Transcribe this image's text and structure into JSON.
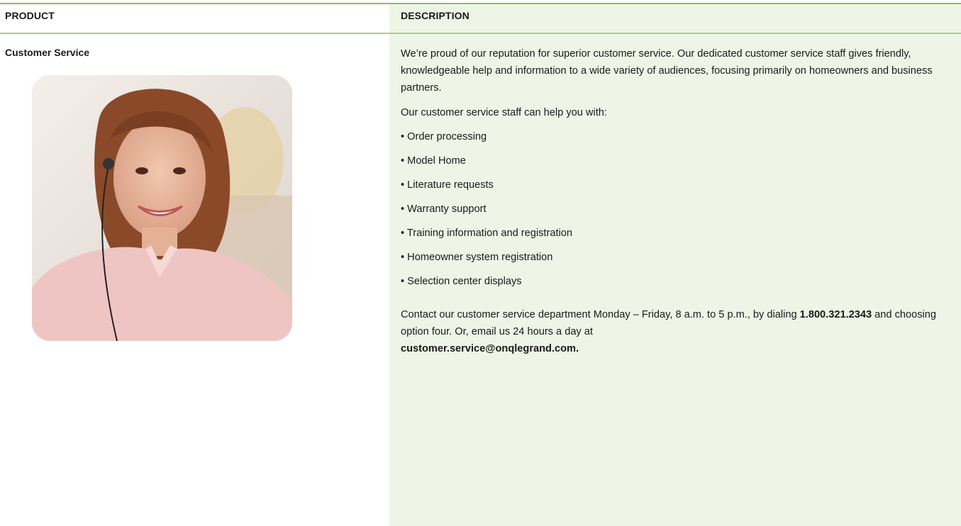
{
  "table": {
    "headers": {
      "product": "PRODUCT",
      "description": "DESCRIPTION"
    },
    "product": {
      "name": "Customer Service"
    },
    "description": {
      "intro": "We’re proud of our reputation for superior customer service. Our dedicated customer service staff gives friendly, knowledgeable help and information to a wide variety of audiences, focusing primarily on homeowners and business partners.",
      "lead": "Our customer service staff can help you with:",
      "bullets": [
        "• Order processing",
        "• Model Home",
        "• Literature requests",
        "• Warranty support",
        "• Training information and registration",
        "• Homeowner system registration",
        "• Selection center displays"
      ],
      "contact": {
        "text_1": "Contact our customer service department Monday – Friday, 8 a.m. to 5 p.m., by dialing ",
        "phone": "1.800.321.2343",
        "text_2": " and choosing option four. Or, email us 24 hours a day at ",
        "email": "customer.service@onqlegrand.com."
      }
    }
  },
  "colors": {
    "rule_green": "#8bc34a",
    "panel_green": "#eef5e6"
  }
}
